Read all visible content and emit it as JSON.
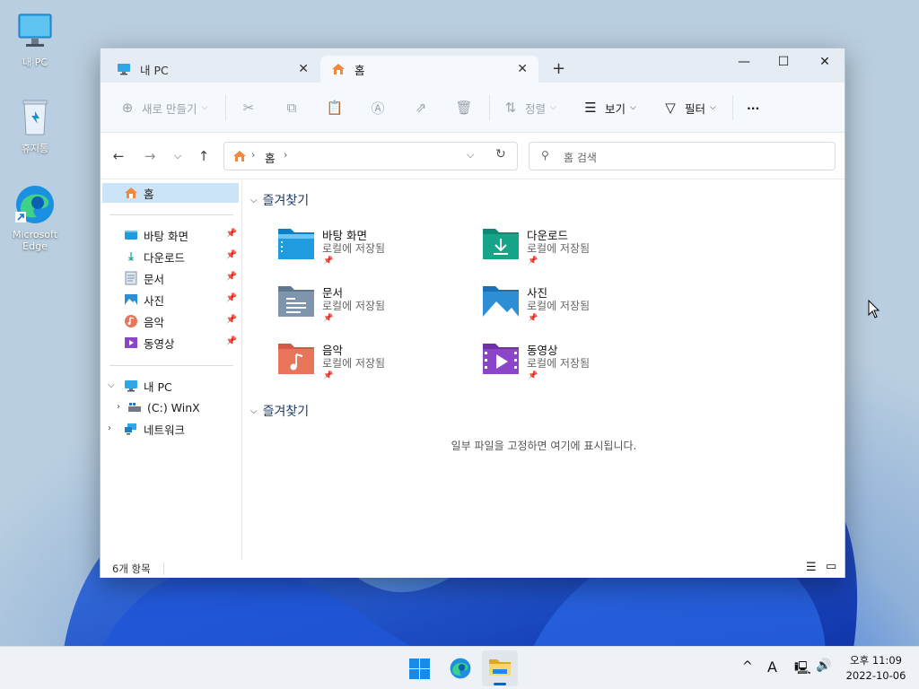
{
  "desktop": {
    "icons": [
      {
        "label": "내 PC",
        "icon": "monitor-icon"
      },
      {
        "label": "휴지통",
        "icon": "recycle-bin-icon"
      },
      {
        "label": "Microsoft Edge",
        "icon": "edge-icon"
      }
    ]
  },
  "window": {
    "tabs": [
      {
        "label": "내 PC",
        "icon": "monitor-icon",
        "active": false
      },
      {
        "label": "홈",
        "icon": "home-icon",
        "active": true
      }
    ],
    "controls": {
      "minimize": "—",
      "maximize": "☐",
      "close": "✕"
    }
  },
  "toolbar": {
    "new_label": "새로 만들기",
    "sort_label": "정렬",
    "view_label": "보기",
    "filter_label": "필터",
    "more_label": "···"
  },
  "address": {
    "crumb": "홈",
    "search_placeholder": "홈 검색"
  },
  "nav": {
    "home": "홈",
    "quick": [
      {
        "label": "바탕 화면",
        "icon": "desktop-icon"
      },
      {
        "label": "다운로드",
        "icon": "download-icon"
      },
      {
        "label": "문서",
        "icon": "document-icon"
      },
      {
        "label": "사진",
        "icon": "pictures-icon"
      },
      {
        "label": "음악",
        "icon": "music-icon"
      },
      {
        "label": "동영상",
        "icon": "video-icon"
      }
    ],
    "this_pc": "내 PC",
    "drive": "(C:) WinX",
    "network": "네트워크"
  },
  "content": {
    "section1": "즐겨찾기",
    "section2": "즐겨찾기",
    "tiles": [
      {
        "name": "바탕 화면",
        "sub": "로컬에 저장됨",
        "color": "#1f9be0"
      },
      {
        "name": "다운로드",
        "sub": "로컬에 저장됨",
        "color": "#17a589"
      },
      {
        "name": "문서",
        "sub": "로컬에 저장됨",
        "color": "#7e95ad"
      },
      {
        "name": "사진",
        "sub": "로컬에 저장됨",
        "color": "#2c8fd6"
      },
      {
        "name": "음악",
        "sub": "로컬에 저장됨",
        "color": "#e8745a"
      },
      {
        "name": "동영상",
        "sub": "로컬에 저장됨",
        "color": "#8c44c8"
      }
    ],
    "empty_message": "일부 파일을 고정하면 여기에 표시됩니다."
  },
  "status": {
    "count": "6개 항목"
  },
  "taskbar": {
    "time": "오후 11:09",
    "date": "2022-10-06",
    "ime": "A",
    "chevron": "^"
  },
  "colors": {
    "accent": "#0067c0",
    "selection": "#cce4f7",
    "folder_tab": "#fdd66b"
  }
}
